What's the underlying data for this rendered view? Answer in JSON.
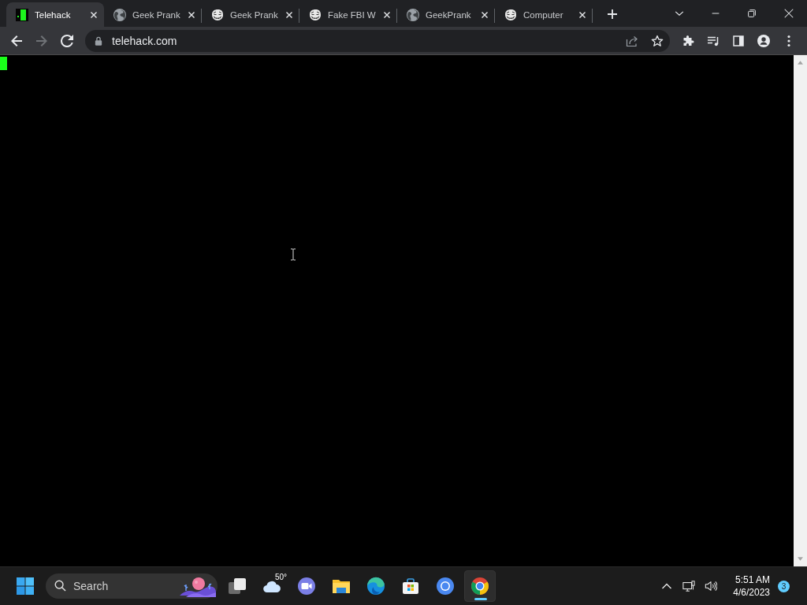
{
  "browser": {
    "tabs": [
      {
        "title": "Telehack",
        "kind": "terminal",
        "selected": true
      },
      {
        "title": "Geek Prank",
        "kind": "globe",
        "selected": false
      },
      {
        "title": "Geek Prank",
        "kind": "grin-face",
        "selected": false
      },
      {
        "title": "Fake FBI W",
        "kind": "grin-face",
        "selected": false
      },
      {
        "title": "GeekPrank",
        "kind": "globe",
        "selected": false
      },
      {
        "title": "Computer",
        "kind": "grin-face",
        "selected": false
      }
    ],
    "nav_buttons": [
      {
        "kind": "back",
        "disabled": false
      },
      {
        "kind": "forward",
        "disabled": true
      },
      {
        "kind": "reload",
        "disabled": false
      }
    ],
    "address_bar": {
      "url": "telehack.com"
    }
  },
  "taskbar": {
    "search": {
      "placeholder": "Search"
    },
    "apps": [
      {
        "kind": "task-view",
        "selected": false
      },
      {
        "kind": "weather",
        "label": "50°",
        "selected": false
      },
      {
        "kind": "chat",
        "selected": false
      },
      {
        "kind": "file-explorer",
        "selected": false
      },
      {
        "kind": "edge",
        "selected": false
      },
      {
        "kind": "store",
        "selected": false
      },
      {
        "kind": "chromium",
        "selected": false
      },
      {
        "kind": "chrome",
        "selected": true
      }
    ],
    "clock": {
      "time": "5:51 AM",
      "date": "4/6/2023"
    },
    "notifications": {
      "count": "3"
    }
  }
}
